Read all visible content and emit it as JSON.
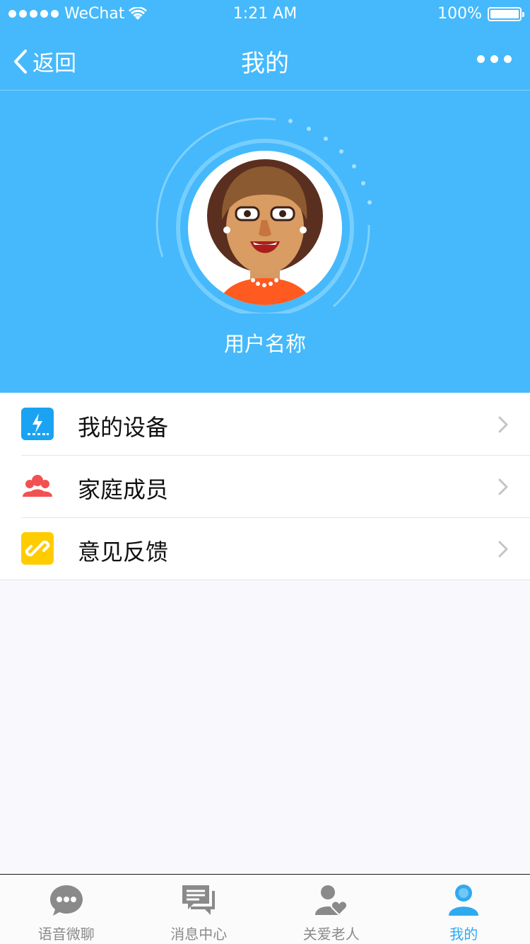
{
  "status_bar": {
    "carrier": "WeChat",
    "time": "1:21 AM",
    "battery": "100%"
  },
  "nav": {
    "back_label": "返回",
    "title": "我的"
  },
  "profile": {
    "username": "用户名称"
  },
  "menu": {
    "items": [
      {
        "label": "我的设备",
        "icon": "device-lightning-icon",
        "color": "#1aa3f2"
      },
      {
        "label": "家庭成员",
        "icon": "family-members-icon",
        "color": "#f25151"
      },
      {
        "label": "意见反馈",
        "icon": "link-feedback-icon",
        "color": "#ffcc00"
      }
    ]
  },
  "tabbar": {
    "items": [
      {
        "label": "语音微聊",
        "icon": "chat-bubble-icon"
      },
      {
        "label": "消息中心",
        "icon": "message-center-icon"
      },
      {
        "label": "关爱老人",
        "icon": "care-elderly-icon"
      },
      {
        "label": "我的",
        "icon": "profile-person-icon"
      }
    ],
    "active_index": 3,
    "active_color": "#2eaaf0",
    "inactive_color": "#8a8a8a"
  },
  "colors": {
    "header_blue": "#45b9fb",
    "background": "#f9f8fd"
  }
}
